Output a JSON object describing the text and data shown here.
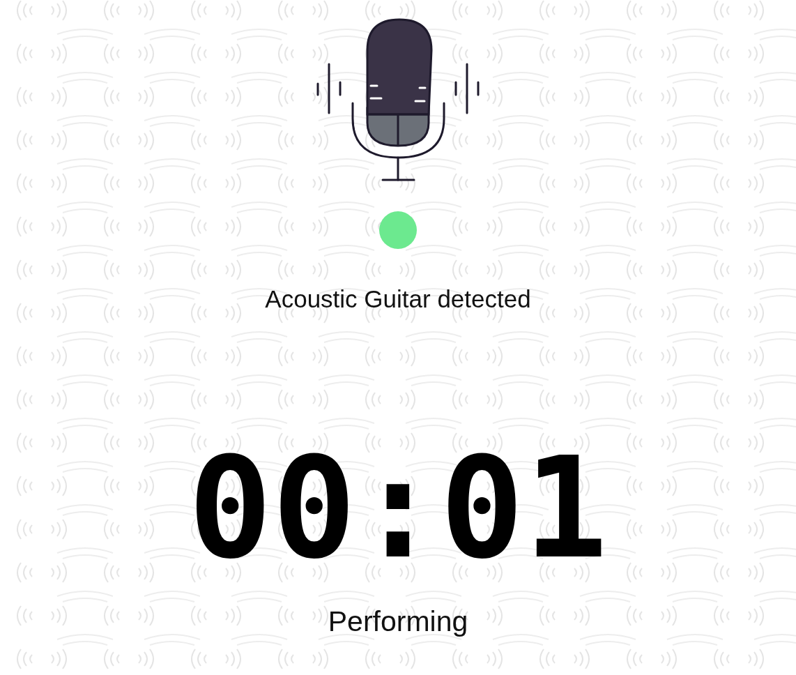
{
  "status": {
    "detected": true,
    "message": "Acoustic Guitar detected"
  },
  "timer": "00:01",
  "state_label": "Performing"
}
